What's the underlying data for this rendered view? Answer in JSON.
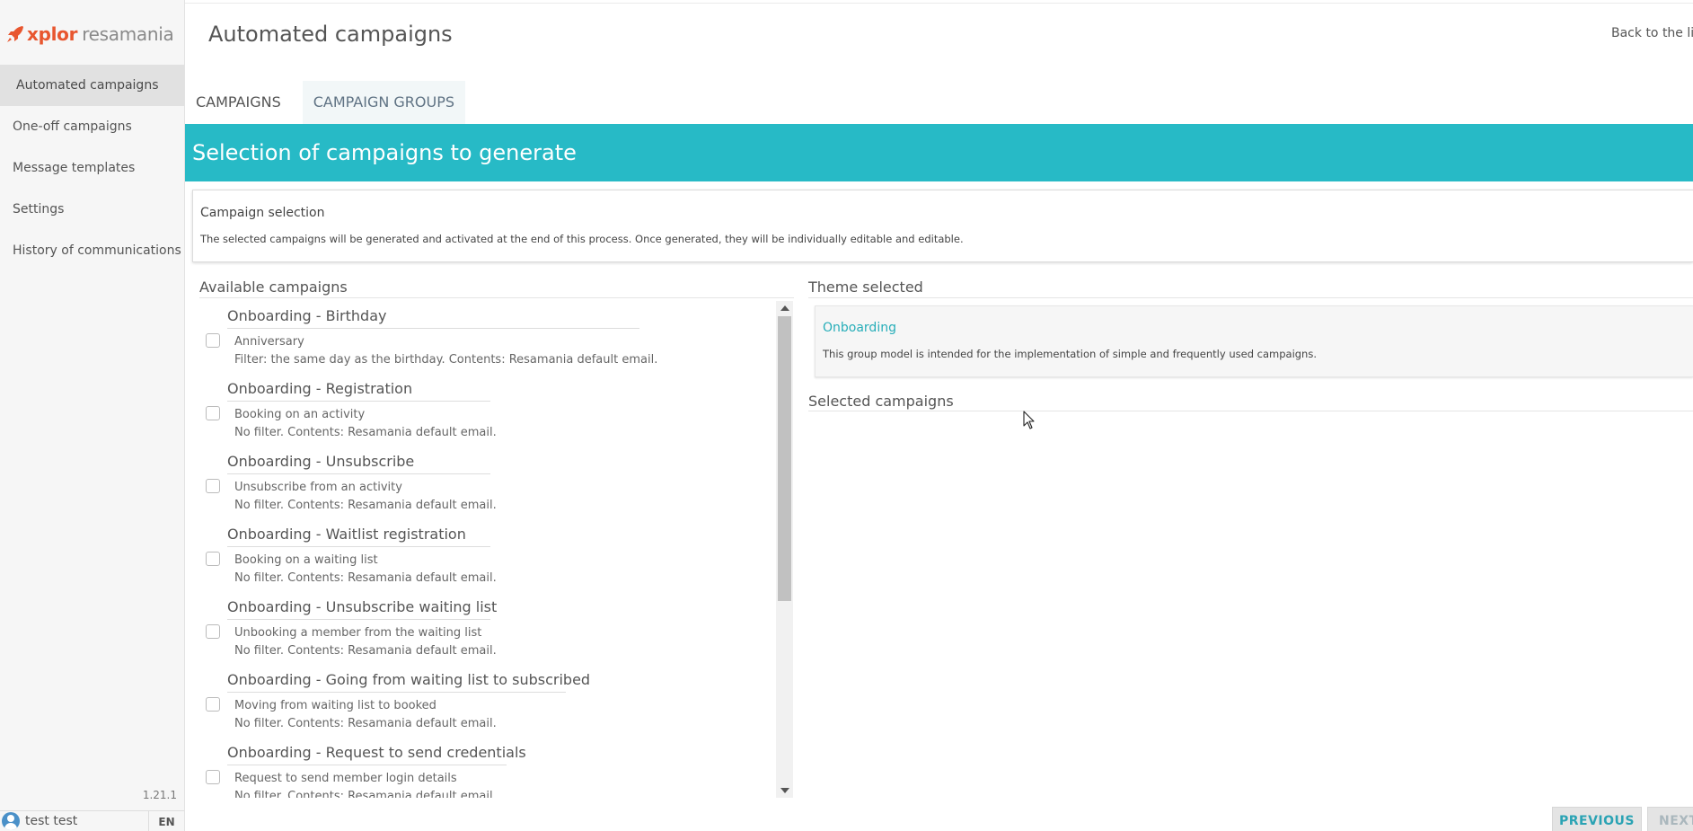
{
  "app": {
    "logo_brand": "xplor",
    "logo_product": "resamania",
    "version": "1.21.1"
  },
  "sidebar": {
    "items": [
      {
        "label": "Automated campaigns",
        "active": true
      },
      {
        "label": "One-off campaigns",
        "active": false
      },
      {
        "label": "Message templates",
        "active": false
      },
      {
        "label": "Settings",
        "active": false
      },
      {
        "label": "History of communications",
        "active": false
      }
    ],
    "user_name": "test test",
    "language": "EN"
  },
  "header": {
    "title": "Automated campaigns",
    "back_link": "Back to the list"
  },
  "tabs": [
    {
      "label": "CAMPAIGNS",
      "active": false
    },
    {
      "label": "CAMPAIGN GROUPS",
      "active": true
    }
  ],
  "banner": {
    "title": "Selection of campaigns to generate"
  },
  "info": {
    "title": "Campaign selection",
    "description": "The selected campaigns will be generated and activated at the end of this process. Once generated, they will be individually editable and editable."
  },
  "available": {
    "title": "Available campaigns",
    "groups": [
      {
        "title": "Onboarding - Birthday",
        "campaign": "Anniversary",
        "description": "Filter: the same day as the birthday. Contents: Resamania default email.",
        "checked": false
      },
      {
        "title": "Onboarding - Registration",
        "campaign": "Booking on an activity",
        "description": "No filter. Contents: Resamania default email.",
        "checked": false
      },
      {
        "title": "Onboarding - Unsubscribe",
        "campaign": "Unsubscribe from an activity",
        "description": "No filter. Contents: Resamania default email.",
        "checked": false
      },
      {
        "title": "Onboarding - Waitlist registration",
        "campaign": "Booking on a waiting list",
        "description": "No filter. Contents: Resamania default email.",
        "checked": false
      },
      {
        "title": "Onboarding - Unsubscribe waiting list",
        "campaign": "Unbooking a member from the waiting list",
        "description": "No filter. Contents: Resamania default email.",
        "checked": false
      },
      {
        "title": "Onboarding - Going from waiting list to subscribed",
        "campaign": "Moving from waiting list to booked",
        "description": "No filter. Contents: Resamania default email.",
        "checked": false
      },
      {
        "title": "Onboarding - Request to send credentials",
        "campaign": "Request to send member login details",
        "description": "No filter. Contents: Resamania default email.",
        "checked": false
      }
    ]
  },
  "theme": {
    "title": "Theme selected",
    "name": "Onboarding",
    "description": "This group model is intended for the implementation of simple and frequently used campaigns."
  },
  "selected": {
    "title": "Selected campaigns"
  },
  "buttons": {
    "previous": "PREVIOUS",
    "next": "NEXT"
  },
  "colors": {
    "accent": "#27bac6",
    "brand": "#e8562f",
    "link": "#27aeb9"
  }
}
